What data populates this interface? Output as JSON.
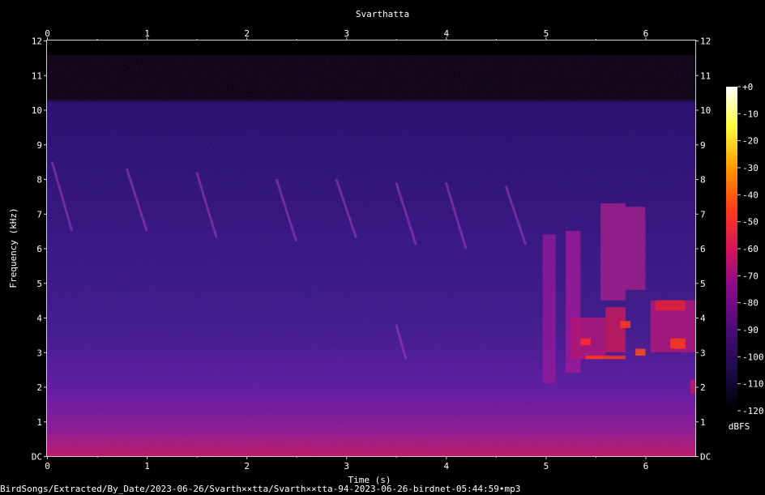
{
  "chart_data": {
    "type": "heatmap",
    "title": "Svarthatta",
    "xlabel": "Time (s)",
    "ylabel": "Frequency (kHz)",
    "xlim": [
      0,
      6.5
    ],
    "ylim": [
      0,
      12
    ],
    "x_ticks": [
      "0",
      "1",
      "2",
      "3",
      "4",
      "5",
      "6"
    ],
    "y_ticks": [
      "DC",
      "1",
      "2",
      "3",
      "4",
      "5",
      "6",
      "7",
      "8",
      "9",
      "10",
      "11",
      "12"
    ],
    "colorbar": {
      "label": "dBFS",
      "ticks": [
        "+0",
        "-10",
        "-20",
        "-30",
        "-40",
        "-50",
        "-60",
        "-70",
        "-80",
        "-90",
        "-100",
        "-110",
        "-120"
      ],
      "range": [
        -120,
        0
      ],
      "colors": [
        "#000000",
        "#1c0a4a",
        "#4a0a7a",
        "#8a0a8a",
        "#d4145a",
        "#ff3a1a",
        "#ff9a00",
        "#ffff40",
        "#ffffff"
      ]
    },
    "source_file": "BirdSongs/Extracted/By_Date/2023-06-26/Svarth××tta/Svarth××tta-94-2023-06-26-birdnet-05:44:59•mp3"
  }
}
